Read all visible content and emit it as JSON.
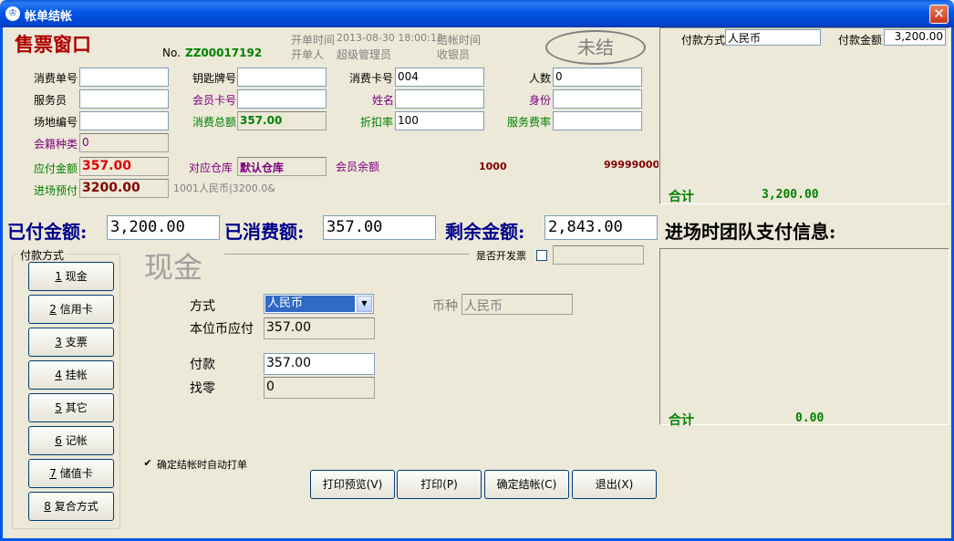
{
  "window": {
    "title": "帐单结帐",
    "close": "✕",
    "app_icon": "ticket-icon"
  },
  "header": {
    "brand": "售票窗口",
    "no_label": "No.",
    "no_value": "ZZ00017192",
    "open_time_label": "开单时间",
    "open_time_value": "2013-08-30 18:00:13",
    "close_time_label": "结帐时间",
    "opener_label": "开单人",
    "opener_value": "超级管理员",
    "cashier_label": "收银员",
    "status_stamp": "未结"
  },
  "form": {
    "consume_no_label": "消费单号",
    "consume_no_value": "",
    "key_no_label": "钥匙牌号",
    "key_no_value": "",
    "card_no_label": "消费卡号",
    "card_no_value": "004",
    "people_label": "人数",
    "people_value": "0",
    "waiter_label": "服务员",
    "waiter_value": "",
    "member_card_label": "会员卡号",
    "member_card_value": "",
    "name_label": "姓名",
    "name_value": "",
    "identity_label": "身份",
    "identity_value": "",
    "site_no_label": "场地编号",
    "site_no_value": "",
    "total_label": "消费总额",
    "total_value": "357.00",
    "discount_label": "折扣率",
    "discount_value": "100",
    "service_label": "服务费率",
    "service_value": "",
    "member_type_label": "会籍种类",
    "member_type_value": "0",
    "payable_label": "应付金额",
    "payable_value": "357.00",
    "warehouse_label": "对应仓库",
    "warehouse_value": "默认仓库",
    "member_balance_label": "会员余额",
    "member_balance_value": "1000",
    "big_number": "999990000",
    "entry_prepay_label": "进场预付",
    "entry_prepay_value": "3200.00",
    "prepay_note": "1001人民币|3200.0&"
  },
  "totals": {
    "paid_label": "已付金额:",
    "paid_value": "3,200.00",
    "consumed_label": "已消费额:",
    "consumed_value": "357.00",
    "remain_label": "剩余金额:",
    "remain_value": "2,843.00",
    "team_label": "进场时团队支付信息:"
  },
  "right_top": {
    "method_label": "付款方式",
    "method_value": "人民币",
    "amount_label": "付款金额",
    "amount_value": "3,200.00",
    "sum_label": "合计",
    "sum_value": "3,200.00"
  },
  "right_bottom": {
    "sum_label": "合计",
    "sum_value": "0.00"
  },
  "payment": {
    "group_label": "付款方式",
    "buttons": [
      {
        "key": "1",
        "label": "现金"
      },
      {
        "key": "2",
        "label": "信用卡"
      },
      {
        "key": "3",
        "label": "支票"
      },
      {
        "key": "4",
        "label": "挂帐"
      },
      {
        "key": "5",
        "label": "其它"
      },
      {
        "key": "6",
        "label": "记帐"
      },
      {
        "key": "7",
        "label": "储值卡"
      },
      {
        "key": "8",
        "label": "复合方式"
      }
    ],
    "current_title": "现金",
    "invoice_label": "是否开发票",
    "mode_label": "方式",
    "mode_value": "人民币",
    "currency_label": "币种",
    "currency_value": "人民币",
    "local_due_label": "本位币应付",
    "local_due_value": "357.00",
    "pay_label": "付款",
    "pay_value": "357.00",
    "change_label": "找零",
    "change_value": "0",
    "auto_print_label": "确定结帐时自动打单"
  },
  "actions": {
    "preview": "打印预览(V)",
    "print": "打印(P)",
    "confirm": "确定结帐(C)",
    "exit": "退出(X)"
  }
}
